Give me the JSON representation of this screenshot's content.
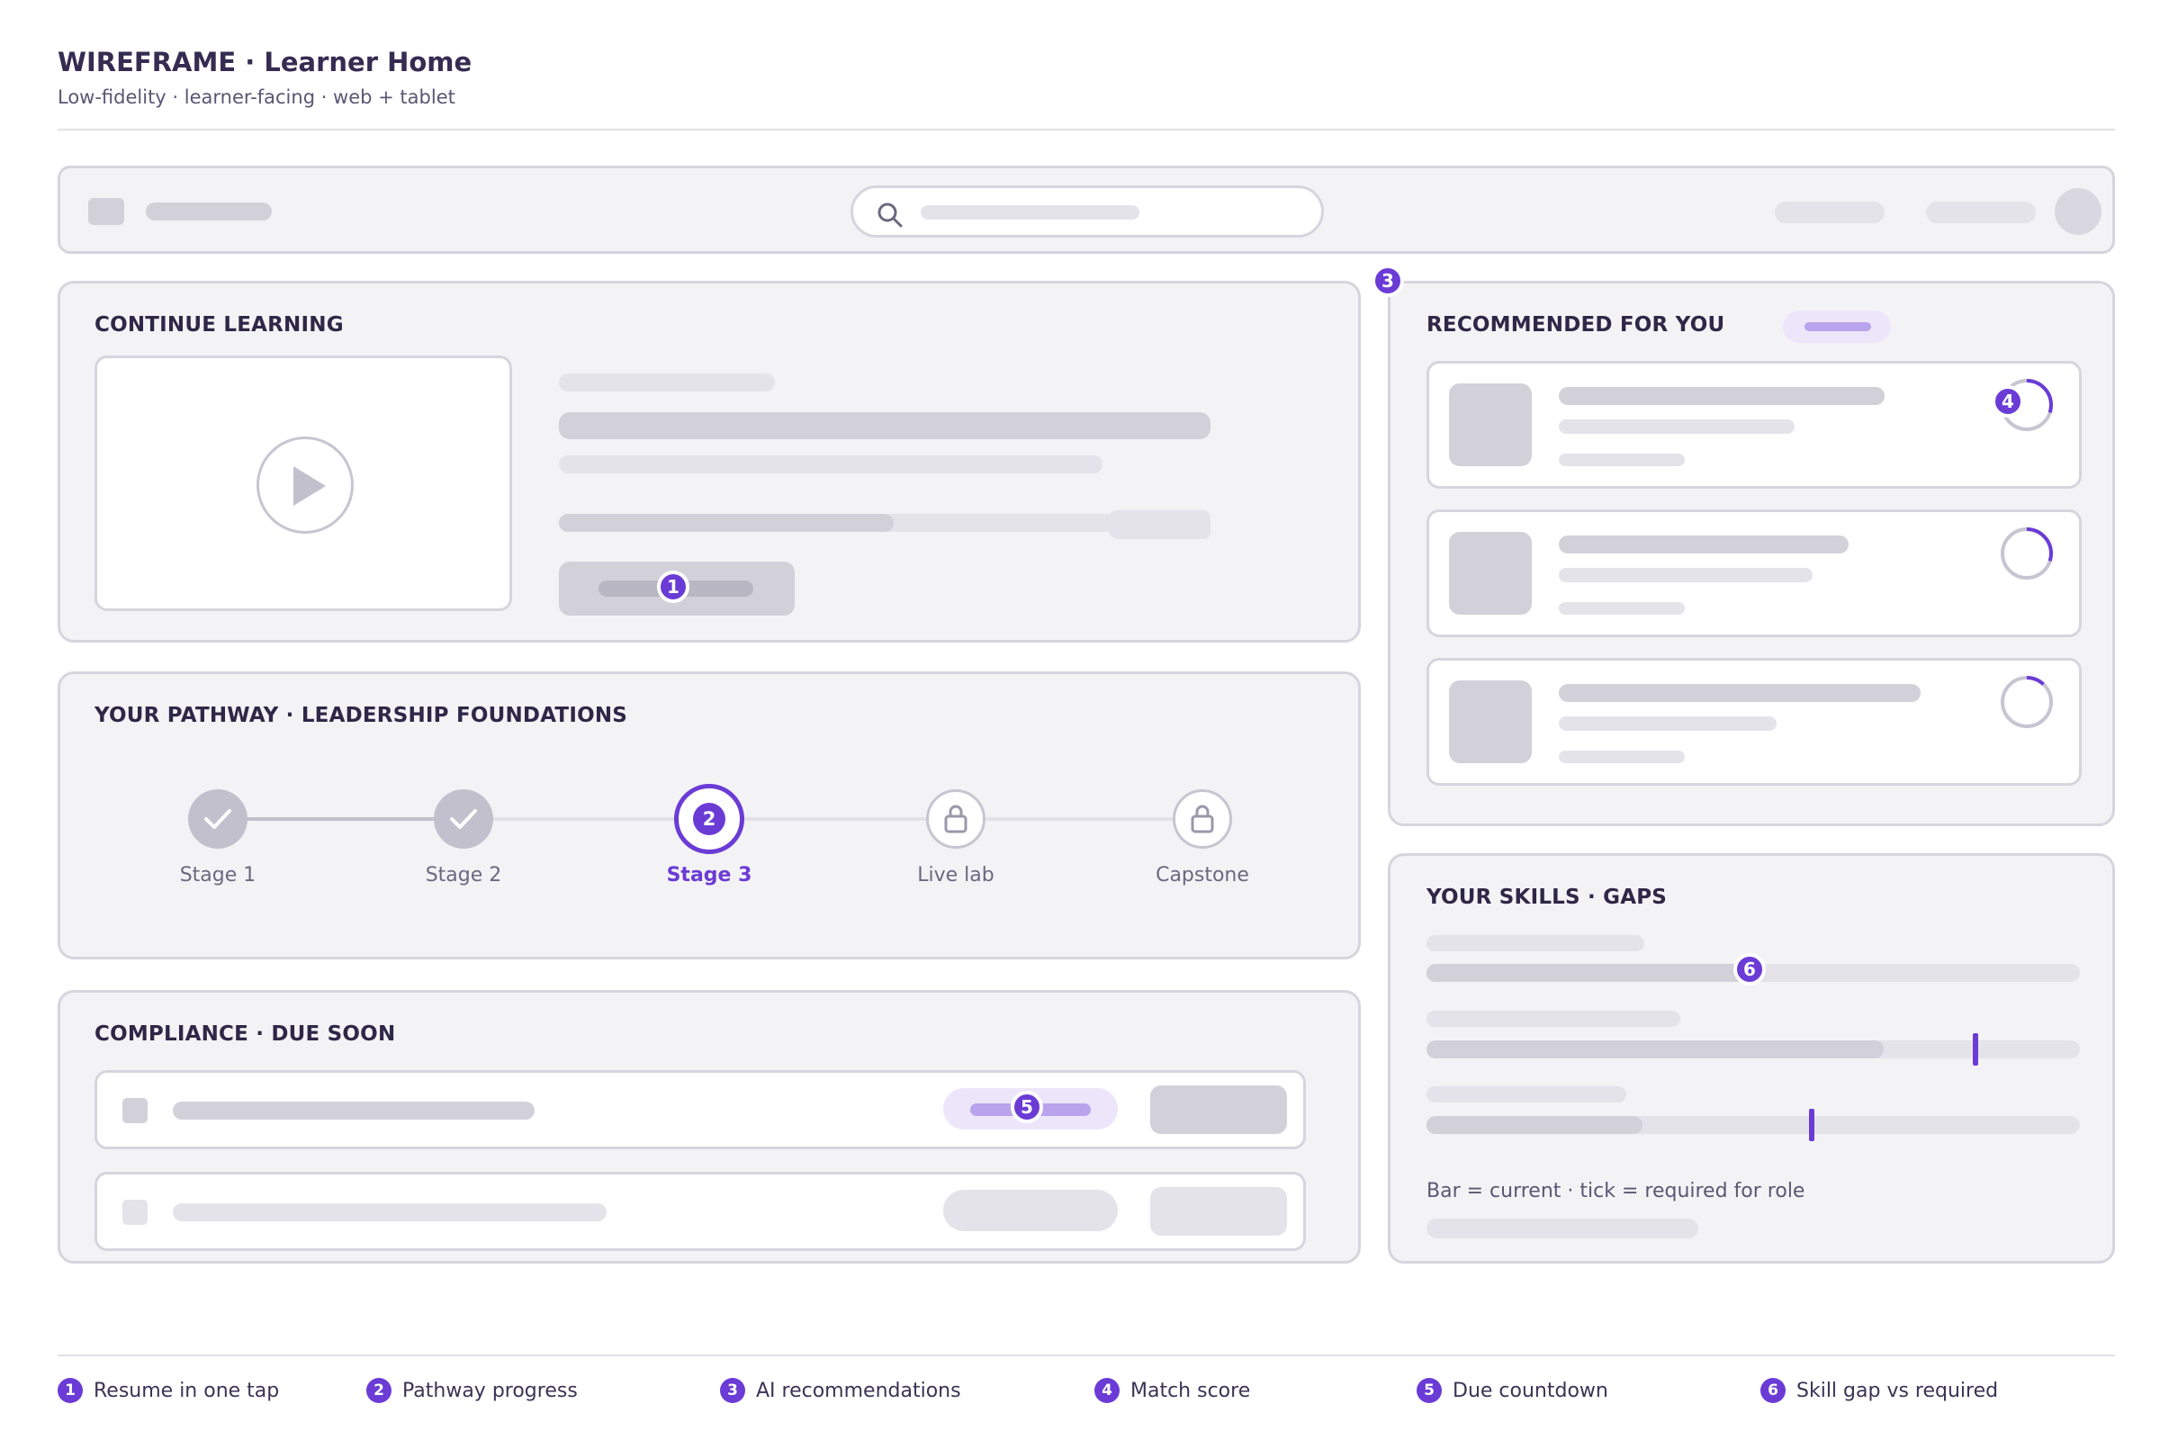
{
  "header": {
    "title": "WIREFRAME · Learner Home",
    "subtitle": "Low-fidelity · learner-facing · web + tablet"
  },
  "continue_learning": {
    "heading": "CONTINUE LEARNING",
    "resume_badge": "1",
    "progress": 0.6
  },
  "recommended": {
    "heading": "RECOMMENDED FOR YOU",
    "section_badge": "3",
    "match_badge": "4",
    "items": [
      {
        "match": 0.3
      },
      {
        "match": 0.3
      },
      {
        "match": 0.12
      }
    ]
  },
  "pathway": {
    "heading": "YOUR PATHWAY · LEADERSHIP FOUNDATIONS",
    "current_badge": "2",
    "stages": [
      {
        "label": "Stage 1",
        "state": "done"
      },
      {
        "label": "Stage 2",
        "state": "done"
      },
      {
        "label": "Stage 3",
        "state": "current"
      },
      {
        "label": "Live lab",
        "state": "locked"
      },
      {
        "label": "Capstone",
        "state": "locked"
      }
    ]
  },
  "compliance": {
    "heading": "COMPLIANCE · DUE SOON",
    "countdown_badge": "5"
  },
  "skills": {
    "heading": "YOUR SKILLS · GAPS",
    "gap_badge": "6",
    "note": "Bar = current · tick = required for role",
    "rows": [
      {
        "current": 0.5,
        "required": 0.5
      },
      {
        "current": 0.7,
        "required": 0.84
      },
      {
        "current": 0.33,
        "required": 0.59
      }
    ]
  },
  "legend": [
    {
      "num": "1",
      "label": "Resume in one tap"
    },
    {
      "num": "2",
      "label": "Pathway progress"
    },
    {
      "num": "3",
      "label": "AI recommendations"
    },
    {
      "num": "4",
      "label": "Match score"
    },
    {
      "num": "5",
      "label": "Due countdown"
    },
    {
      "num": "6",
      "label": "Skill gap vs required"
    }
  ],
  "colors": {
    "accent": "#6b3bd6",
    "panel": "#f3f3f6",
    "border": "#d6d5de"
  }
}
